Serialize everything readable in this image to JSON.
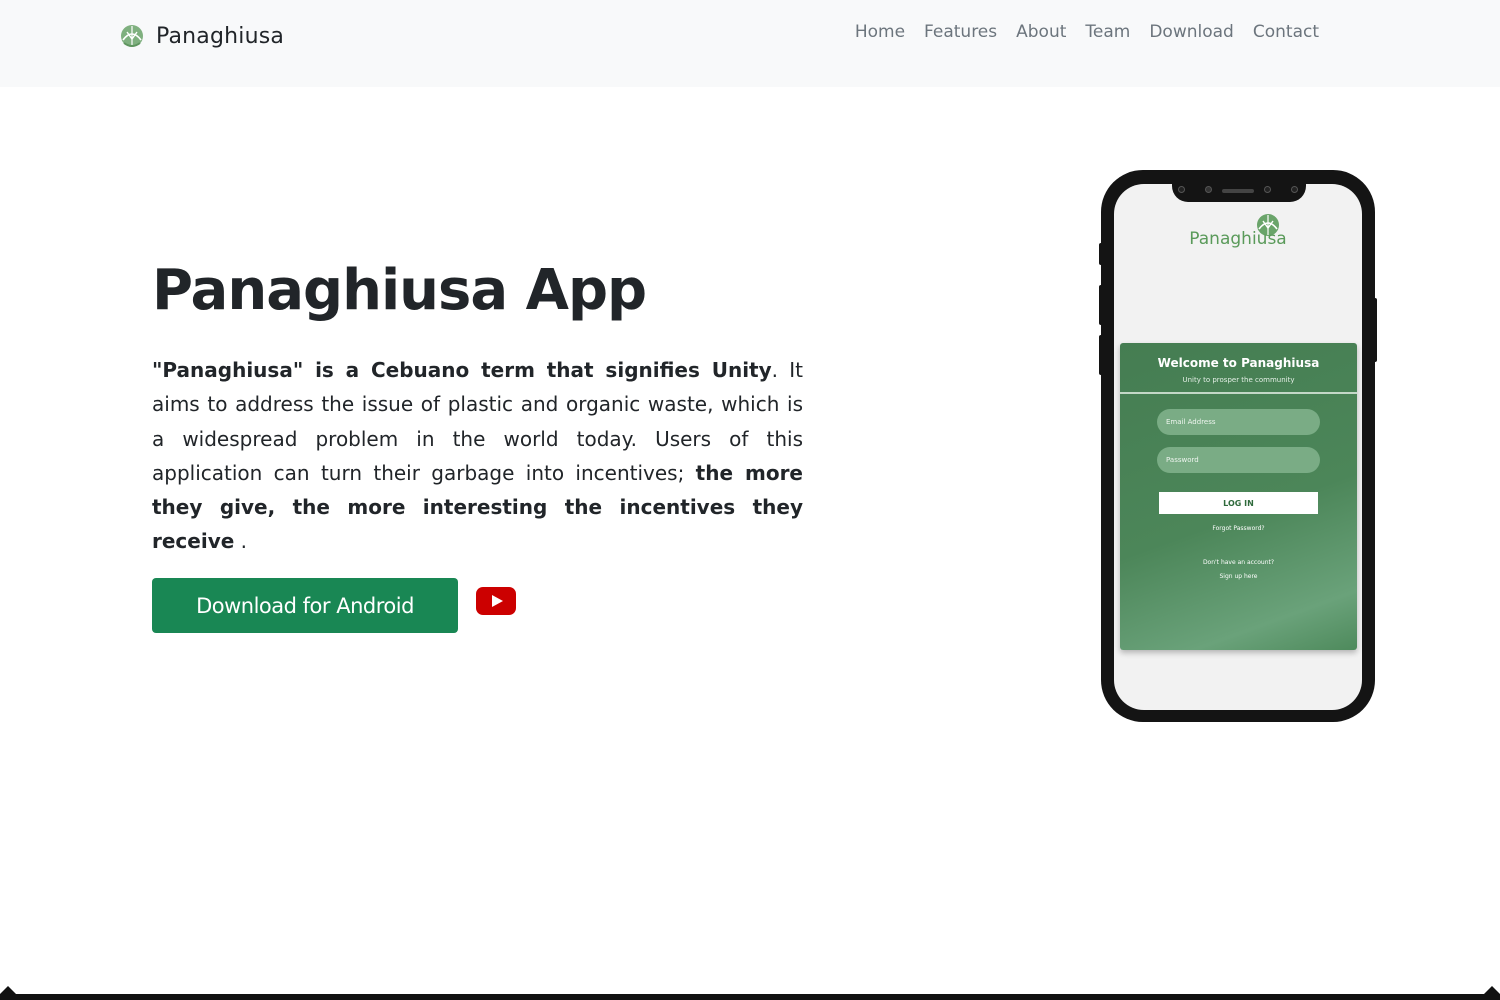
{
  "navbar": {
    "brand": "Panaghiusa",
    "links": [
      {
        "label": "Home"
      },
      {
        "label": "Features"
      },
      {
        "label": "About"
      },
      {
        "label": "Team"
      },
      {
        "label": "Download"
      },
      {
        "label": "Contact"
      }
    ]
  },
  "hero": {
    "title": "Panaghiusa App",
    "desc_bold_1": "\"Panaghiusa\" is a Cebuano term that signifies Unity",
    "desc_text": ". It aims to address the issue of plastic and organic waste, which is a widespread problem in the world today. Users of this application can turn their garbage into incentives; ",
    "desc_bold_2": "the more they give, the more interesting the incentives they receive",
    "desc_end": " .",
    "download_button": "Download for Android",
    "video_icon": "youtube-play-icon"
  },
  "phone": {
    "app_name": "Panaghiusa",
    "card_title": "Welcome to Panaghiusa",
    "card_subtitle": "Unity to prosper the community",
    "email_placeholder": "Email Address",
    "password_placeholder": "Password",
    "login_label": "LOG IN",
    "forgot_label": "Forgot Password?",
    "no_account_label": "Don't have an account?",
    "signup_label": "Sign up here"
  },
  "colors": {
    "brand_green": "#198754",
    "navbar_bg": "#f8f9fa",
    "nav_link": "#6c757d",
    "card_green": "#4c8659",
    "youtube_red": "#cc0000"
  }
}
